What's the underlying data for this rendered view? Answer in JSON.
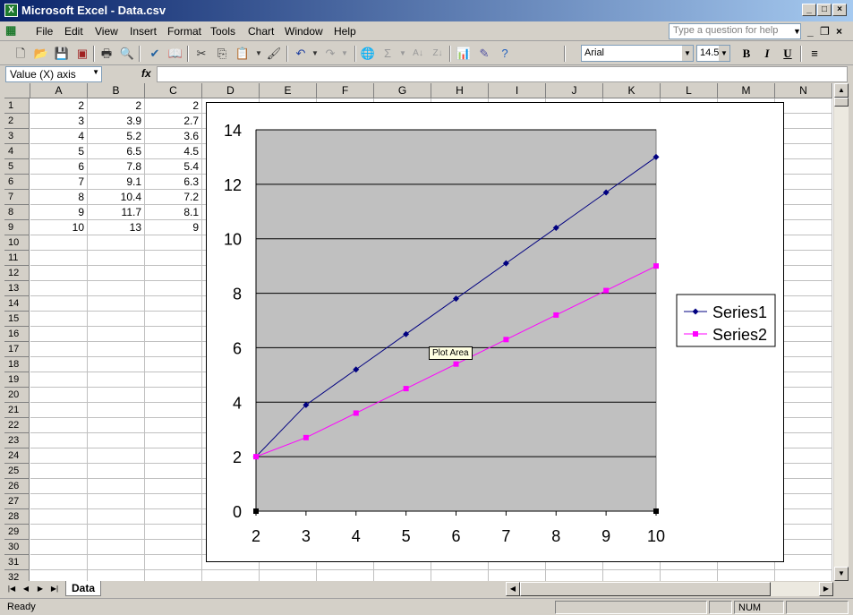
{
  "window": {
    "title": "Microsoft Excel - Data.csv",
    "app_icon": "X"
  },
  "menu": {
    "items": [
      "File",
      "Edit",
      "View",
      "Insert",
      "Format",
      "Tools",
      "Chart",
      "Window",
      "Help"
    ],
    "help_placeholder": "Type a question for help"
  },
  "toolbar": {
    "font_name": "Arial",
    "font_size": "14.5",
    "bold": "B",
    "italic": "I",
    "underline": "U"
  },
  "formula": {
    "name_box": "Value (X) axis",
    "fx": "fx"
  },
  "columns": [
    "A",
    "B",
    "C",
    "D",
    "E",
    "F",
    "G",
    "H",
    "I",
    "J",
    "K",
    "L",
    "M",
    "N"
  ],
  "rows": [
    "1",
    "2",
    "3",
    "4",
    "5",
    "6",
    "7",
    "8",
    "9",
    "10",
    "11",
    "12",
    "13",
    "14",
    "15",
    "16",
    "17",
    "18",
    "19",
    "20",
    "21",
    "22",
    "23",
    "24",
    "25",
    "26",
    "27",
    "28",
    "29",
    "30",
    "31",
    "32"
  ],
  "cells": {
    "A": [
      "2",
      "3",
      "4",
      "5",
      "6",
      "7",
      "8",
      "9",
      "10"
    ],
    "B": [
      "2",
      "3.9",
      "5.2",
      "6.5",
      "7.8",
      "9.1",
      "10.4",
      "11.7",
      "13"
    ],
    "C": [
      "2",
      "2.7",
      "3.6",
      "4.5",
      "5.4",
      "6.3",
      "7.2",
      "8.1",
      "9"
    ]
  },
  "chart_data": {
    "type": "line",
    "x": [
      2,
      3,
      4,
      5,
      6,
      7,
      8,
      9,
      10
    ],
    "series": [
      {
        "name": "Series1",
        "values": [
          2,
          3.9,
          5.2,
          6.5,
          7.8,
          9.1,
          10.4,
          11.7,
          13
        ],
        "color": "#000080"
      },
      {
        "name": "Series2",
        "values": [
          2,
          2.7,
          3.6,
          4.5,
          5.4,
          6.3,
          7.2,
          8.1,
          9
        ],
        "color": "#ff00ff"
      }
    ],
    "title": "",
    "xlabel": "",
    "ylabel": "",
    "ylim": [
      0,
      14
    ],
    "yticks": [
      "0",
      "2",
      "4",
      "6",
      "8",
      "10",
      "12",
      "14"
    ],
    "xticks": [
      "2",
      "3",
      "4",
      "5",
      "6",
      "7",
      "8",
      "9",
      "10"
    ],
    "grid": true,
    "legend": "right",
    "plot_background": "#c0c0c0"
  },
  "tooltip": "Plot Area",
  "sheet_tab": "Data",
  "status": {
    "left": "Ready",
    "num": "NUM"
  }
}
